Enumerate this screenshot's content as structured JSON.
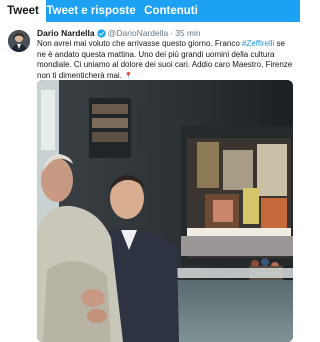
{
  "tabs": [
    {
      "label": "Tweet"
    },
    {
      "label": "Tweet e risposte"
    },
    {
      "label": "Contenuti"
    }
  ],
  "tweet": {
    "author_name": "Dario Nardella",
    "handle": "@DarioNardella",
    "separator": "·",
    "time": "35 min",
    "text_before": "Non avrei mai voluto che arrivasse questo giorno. Franco ",
    "hashtag": "#Zeffirelli",
    "text_after": " se ne è andato questa mattina. Uno dei più grandi uomini della cultura mondiale. Ci uniamo al dolore dei suoi cari. Addio caro Maestro, Firenze non ti dimenticherà mai.",
    "pin_emoji": "📍"
  },
  "colors": {
    "accent": "#1da1f2",
    "link": "#1b95e0",
    "muted": "#657786"
  },
  "icons": {
    "verified": "verified-badge-icon"
  }
}
